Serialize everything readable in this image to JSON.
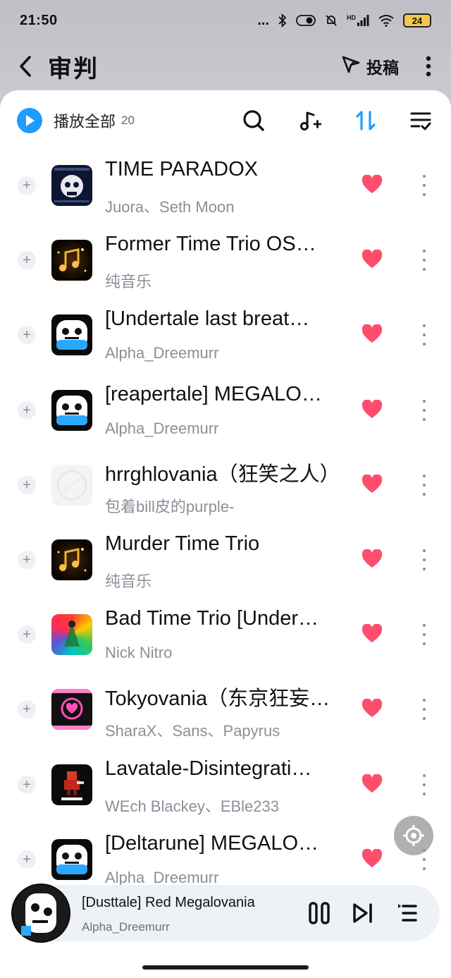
{
  "status_bar": {
    "time": "21:50",
    "dots": "...",
    "network": "HD",
    "battery": "24"
  },
  "header": {
    "title": "审判",
    "contribute_label": "投稿"
  },
  "toolbar": {
    "play_all_label": "播放全部",
    "count": "20"
  },
  "songs": [
    {
      "title": "TIME PARADOX",
      "artist": "Juora、Seth Moon",
      "cover": "skull-cover",
      "liked": true
    },
    {
      "title": "Former Time Trio OS…",
      "artist": "纯音乐",
      "cover": "golden-notes-cover",
      "liked": true
    },
    {
      "title": "[Undertale last breat…",
      "artist": "Alpha_Dreemurr",
      "cover": "sans-skull-cover",
      "liked": true
    },
    {
      "title": "[reapertale] MEGALO…",
      "artist": "Alpha_Dreemurr",
      "cover": "sans-skull-cover",
      "liked": true
    },
    {
      "title": "hrrghlovania（狂笑之人）",
      "artist": "包着bill皮的purple-",
      "cover": "blank-cover",
      "liked": true
    },
    {
      "title": "Murder Time Trio",
      "artist": "纯音乐",
      "cover": "golden-notes-cover",
      "liked": true
    },
    {
      "title": "Bad Time Trio [Under…",
      "artist": "Nick Nitro",
      "cover": "rainbow-cover",
      "liked": true
    },
    {
      "title": "Tokyovania（东京狂妄…",
      "artist": "SharaX、Sans、Papyrus",
      "cover": "pink-heart-cover",
      "liked": true
    },
    {
      "title": "Lavatale-Disintegrati…",
      "artist": "WEch Blackey、EBle233",
      "cover": "ent-cover",
      "liked": true
    },
    {
      "title": "[Deltarune] MEGALO…",
      "artist": "Alpha_Dreemurr",
      "cover": "sans-skull-cover",
      "liked": true
    }
  ],
  "mini_player": {
    "title": "[Dusttale] Red Megalovania",
    "artist": "Alpha_Dreemurr"
  },
  "colors": {
    "accent_blue": "#1f9cff",
    "heart_pink": "#ff4d6d",
    "subtitle_gray": "#8b8f98"
  },
  "icons": [
    "back-arrow-icon",
    "send-icon",
    "more-vertical-icon",
    "play-icon",
    "search-icon",
    "add-music-icon",
    "sort-icon",
    "multi-select-icon",
    "plus-icon",
    "heart-icon",
    "pause-icon",
    "next-track-icon",
    "queue-icon",
    "target-icon"
  ]
}
